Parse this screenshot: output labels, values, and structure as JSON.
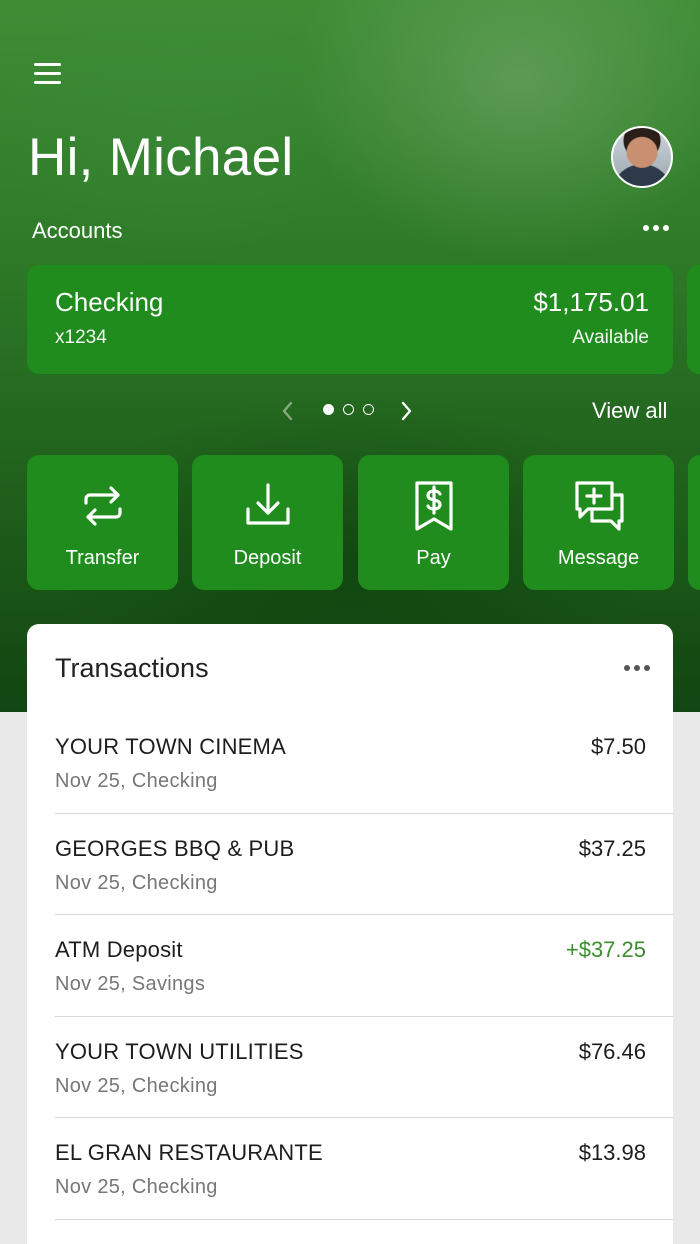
{
  "header": {
    "greeting": "Hi, Michael",
    "menu_icon": "hamburger-menu-icon",
    "avatar_icon": "user-avatar"
  },
  "accounts": {
    "label": "Accounts",
    "more_icon": "more-horizontal-icon",
    "card": {
      "name": "Checking",
      "number": "x1234",
      "balance": "$1,175.01",
      "balance_label": "Available"
    },
    "pager": {
      "total_pages": 3,
      "active_page": 1
    },
    "view_all": "View all"
  },
  "actions": [
    {
      "label": "Transfer",
      "icon": "transfer-arrows-icon"
    },
    {
      "label": "Deposit",
      "icon": "download-tray-icon"
    },
    {
      "label": "Pay",
      "icon": "dollar-receipt-icon"
    },
    {
      "label": "Message",
      "icon": "message-plus-icon"
    }
  ],
  "transactions": {
    "title": "Transactions",
    "items": [
      {
        "merchant": "YOUR TOWN CINEMA",
        "details": "Nov 25, Checking",
        "amount": "$7.50",
        "credit": false
      },
      {
        "merchant": "GEORGES BBQ & PUB",
        "details": "Nov 25, Checking",
        "amount": "$37.25",
        "credit": false
      },
      {
        "merchant": "ATM Deposit",
        "details": "Nov 25, Savings",
        "amount": "+$37.25",
        "credit": true
      },
      {
        "merchant": "YOUR TOWN UTILITIES",
        "details": "Nov 25, Checking",
        "amount": "$76.46",
        "credit": false
      },
      {
        "merchant": "EL GRAN RESTAURANTE",
        "details": "Nov 25, Checking",
        "amount": "$13.98",
        "credit": false
      }
    ]
  },
  "colors": {
    "brand_green": "#1f8c1d",
    "credit_green": "#3c8d2f"
  }
}
